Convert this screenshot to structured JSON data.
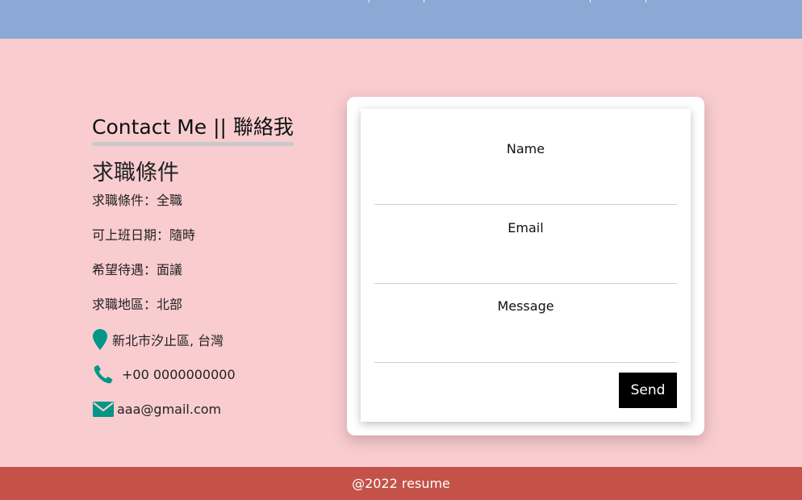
{
  "contact": {
    "heading": "Contact Me || 聯絡我",
    "conditions_title": "求職條件",
    "conditions": [
      "求職條件：全職",
      "可上班日期：隨時",
      "希望待遇：面議",
      "求職地區：北部"
    ],
    "address": "新北市汐止區, 台灣",
    "phone": "+00 0000000000",
    "email": "aaa@gmail.com",
    "icons": {
      "address": "map-pin-icon",
      "phone": "phone-icon",
      "email": "envelope-icon"
    }
  },
  "form": {
    "name_label": "Name",
    "email_label": "Email",
    "message_label": "Message",
    "send_label": "Send"
  },
  "footer": {
    "text": "@2022 resume"
  },
  "colors": {
    "page_bg": "#f9cdd0",
    "topbar_bg": "#8ba9d4",
    "footer_bg": "#c45248",
    "icon_accent": "#009688",
    "button_bg": "#000000"
  }
}
